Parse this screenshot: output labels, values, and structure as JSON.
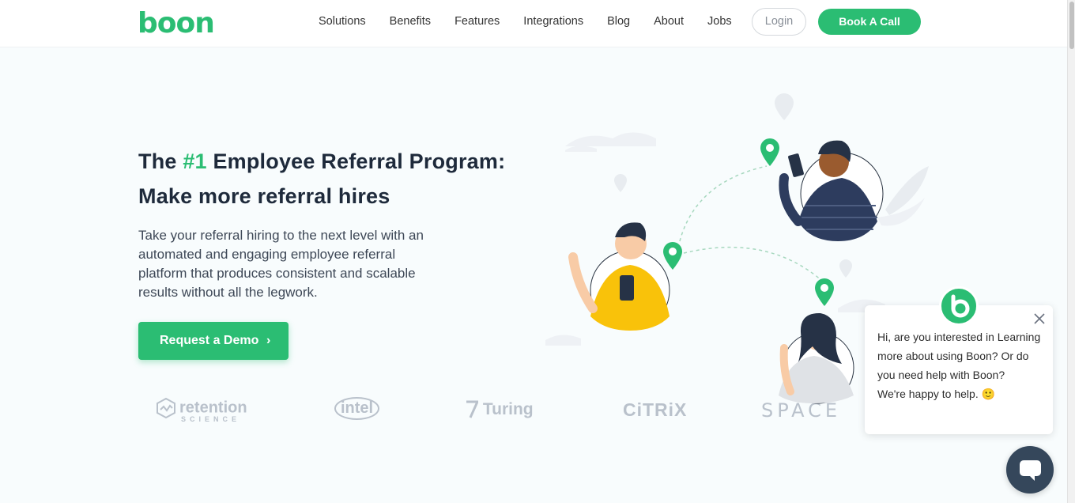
{
  "header": {
    "logo": "boon",
    "nav": [
      "Solutions",
      "Benefits",
      "Features",
      "Integrations",
      "Blog",
      "About",
      "Jobs"
    ],
    "login_label": "Login",
    "book_label": "Book A Call"
  },
  "hero": {
    "title_pre": "The ",
    "title_accent": "#1",
    "title_post": " Employee Referral Program:",
    "title_line2": "Make more referral hires",
    "subtitle": "Take your referral hiring to the next level with an automated and engaging employee referral platform that produces consistent and scalable results without all the legwork.",
    "cta_label": "Request a Demo"
  },
  "logos": {
    "retention": "retention",
    "retention_sub": "SCIENCE",
    "intel": "intel",
    "turing": "Turing",
    "citrix": "CiTRiX",
    "space": "SPACE"
  },
  "chat": {
    "message": "Hi, are you interested in Learning more about using Boon? Or do you need help with Boon?",
    "message2": "We're happy to help. 🙂"
  },
  "colors": {
    "brand_green": "#2bbd73",
    "dark_navy": "#1e2a3b",
    "chat_launcher": "#35475b"
  }
}
